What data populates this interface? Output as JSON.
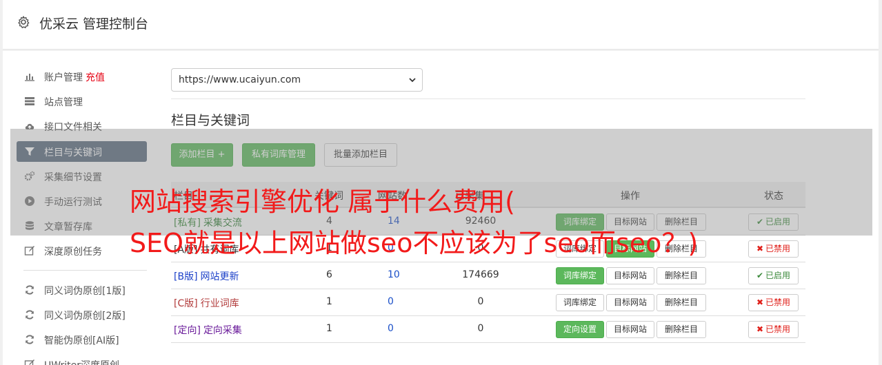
{
  "header": {
    "title": "优采云 管理控制台",
    "icon": "gear-icon"
  },
  "sidebar": {
    "items": [
      {
        "label": "账户管理",
        "extra": "充值",
        "icon": "bar-chart-icon"
      },
      {
        "label": "站点管理",
        "icon": "server-icon"
      },
      {
        "label": "接口文件相关",
        "icon": "cloud-upload-icon"
      },
      {
        "label": "栏目与关键词",
        "icon": "filter-icon",
        "active": true
      },
      {
        "label": "采集细节设置",
        "icon": "cogs-icon"
      },
      {
        "label": "手动运行测试",
        "icon": "play-circle-icon"
      },
      {
        "label": "文章暂存库",
        "icon": "database-icon"
      },
      {
        "label": "深度原创任务",
        "icon": "edit-icon"
      },
      {
        "label": "同义词伪原创[1版]",
        "icon": "refresh-icon"
      },
      {
        "label": "同义词伪原创[2版]",
        "icon": "refresh-icon"
      },
      {
        "label": "智能伪原创[AI版]",
        "icon": "refresh-icon"
      },
      {
        "label": "UWriter深度原创",
        "icon": "edit-icon"
      }
    ]
  },
  "site_select": {
    "value": "https://www.ucaiyun.com"
  },
  "section": {
    "title": "栏目与关键词"
  },
  "toolbar": {
    "add_column": "添加栏目 +",
    "private_lexicon": "私有词库管理",
    "batch_add": "批量添加栏目"
  },
  "table": {
    "headers": {
      "col1": "栏目",
      "col2": "关键词",
      "col3": "网站数",
      "col4": "已采集",
      "ops": "操作",
      "status": "状态"
    },
    "rows": [
      {
        "tag": "[私有]",
        "name": "采集交流",
        "c1": "4",
        "c2": "14",
        "c3": "92460",
        "op1": "词库绑定",
        "op1_green": true,
        "op2": "目标网站",
        "op2_green": false,
        "op3": "删除栏目",
        "status": "已启用",
        "on": true,
        "tag_color": "#3c8a3c",
        "link_color": "#2e7d32"
      },
      {
        "tag": "[A版]",
        "name": "共有词库",
        "c1": "1",
        "c2": "0",
        "c3": "0",
        "op1": "词库绑定",
        "op1_green": false,
        "op2": "目标网站",
        "op2_green": true,
        "op3": "删除栏目",
        "status": "已禁用",
        "on": false,
        "tag_color": "#333333",
        "link_color": "#333333"
      },
      {
        "tag": "[B版]",
        "name": "网站更新",
        "c1": "6",
        "c2": "10",
        "c3": "174669",
        "op1": "词库绑定",
        "op1_green": true,
        "op2": "目标网站",
        "op2_green": false,
        "op3": "删除栏目",
        "status": "已启用",
        "on": true,
        "tag_color": "#1a3fc8",
        "link_color": "#1a3fc8"
      },
      {
        "tag": "[C版]",
        "name": "行业词库",
        "c1": "1",
        "c2": "0",
        "c3": "0",
        "op1": "词库绑定",
        "op1_green": false,
        "op2": "目标网站",
        "op2_green": false,
        "op3": "删除栏目",
        "status": "已禁用",
        "on": false,
        "tag_color": "#b23b3b",
        "link_color": "#b23b3b"
      },
      {
        "tag": "[定向]",
        "name": "定向采集",
        "c1": "1",
        "c2": "0",
        "c3": "0",
        "op1": "定向设置",
        "op1_green": true,
        "op2": "目标网站",
        "op2_green": false,
        "op3": "删除栏目",
        "status": "已禁用",
        "on": false,
        "tag_color": "#6a1b9a",
        "link_color": "#6a1b9a"
      }
    ]
  },
  "overlay": {
    "line1": "网站搜索引擎优化 属于什么费用(",
    "line2": "SEO就是以上网站做seo不应该为了seo而seo？)"
  }
}
